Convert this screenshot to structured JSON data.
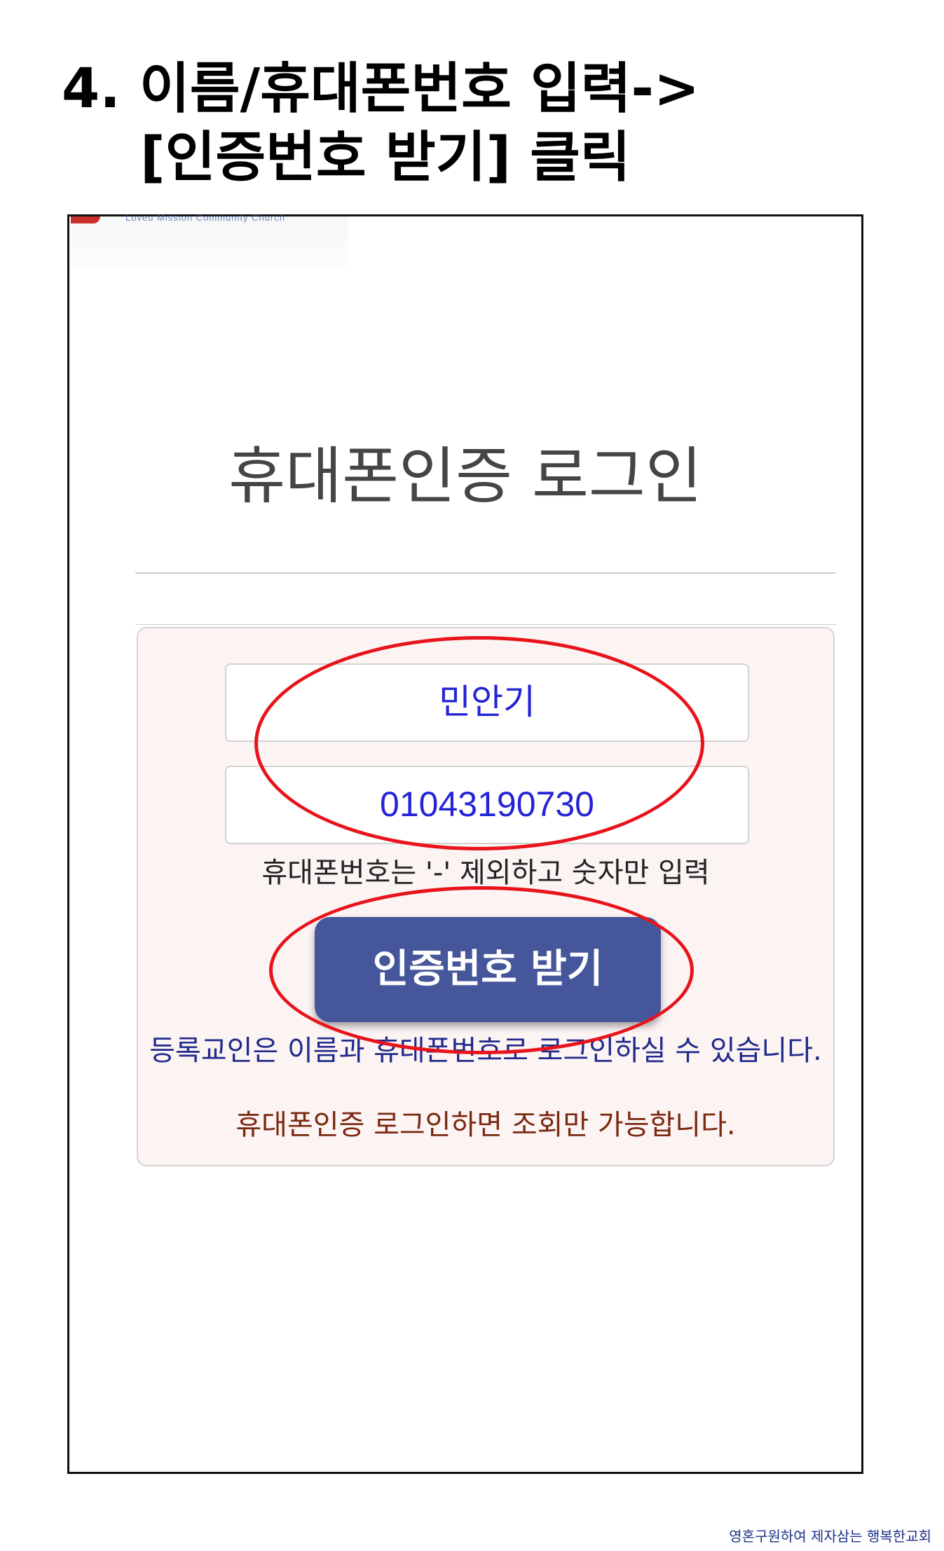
{
  "slide": {
    "title_line1": "4. 이름/휴대폰번호 입력->",
    "title_line2": "[인증번호 받기] 클릭"
  },
  "page": {
    "logo_text": "Loveu Mission Community Church",
    "heading": "휴대폰인증 로그인"
  },
  "form": {
    "name_value": "민안기",
    "phone_value": "01043190730",
    "phone_hint": "휴대폰번호는 '-' 제외하고 숫자만 입력",
    "submit_label": "인증번호 받기",
    "notice_registered": "등록교인은 이름과 휴대폰번호로 로그인하실 수 있습니다.",
    "notice_readonly": "휴대폰인증 로그인하면 조회만 가능합니다."
  },
  "footer": {
    "brand": "영혼구원하여 제자삼는 행복한교회"
  },
  "colors": {
    "annotation": "#e8131b",
    "button": "#46569a",
    "panel": "#fcf3f3",
    "input_text": "#2424d6"
  }
}
